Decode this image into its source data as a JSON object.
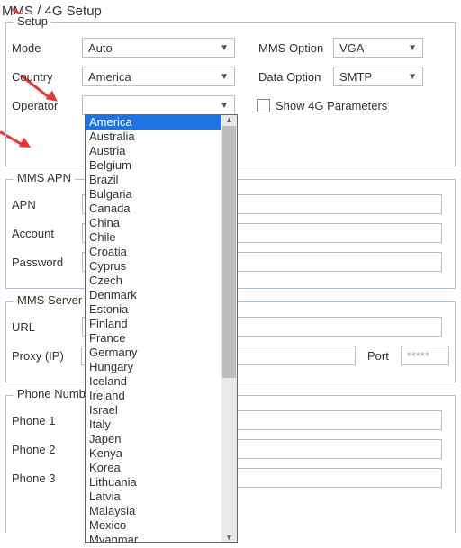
{
  "title": "MMS / 4G Setup",
  "setup": {
    "legend": "Setup",
    "mode_label": "Mode",
    "mode_value": "Auto",
    "mms_option_label": "MMS Option",
    "mms_option_value": "VGA",
    "country_label": "Country",
    "country_value": "America",
    "data_option_label": "Data Option",
    "data_option_value": "SMTP",
    "operator_label": "Operator",
    "operator_value": "",
    "show4g_label": "Show 4G Parameters",
    "country_options": [
      "America",
      "Australia",
      "Austria",
      "Belgium",
      "Brazil",
      "Bulgaria",
      "Canada",
      "China",
      "Chile",
      "Croatia",
      "Cyprus",
      "Czech",
      "Denmark",
      "Estonia",
      "Finland",
      "France",
      "Germany",
      "Hungary",
      "Iceland",
      "Ireland",
      "Israel",
      "Italy",
      "Japen",
      "Kenya",
      "Korea",
      "Lithuania",
      "Latvia",
      "Malaysia",
      "Mexico",
      "Myanmar"
    ]
  },
  "apn": {
    "legend": "MMS APN",
    "apn_label": "APN",
    "account_label": "Account",
    "password_label": "Password"
  },
  "server": {
    "legend": "MMS Server",
    "url_label": "URL",
    "proxy_label": "Proxy (IP)",
    "port_label": "Port",
    "port_value": "*****"
  },
  "phones": {
    "legend": "Phone Number",
    "p1": "Phone 1",
    "p2": "Phone 2",
    "p3": "Phone 3"
  }
}
